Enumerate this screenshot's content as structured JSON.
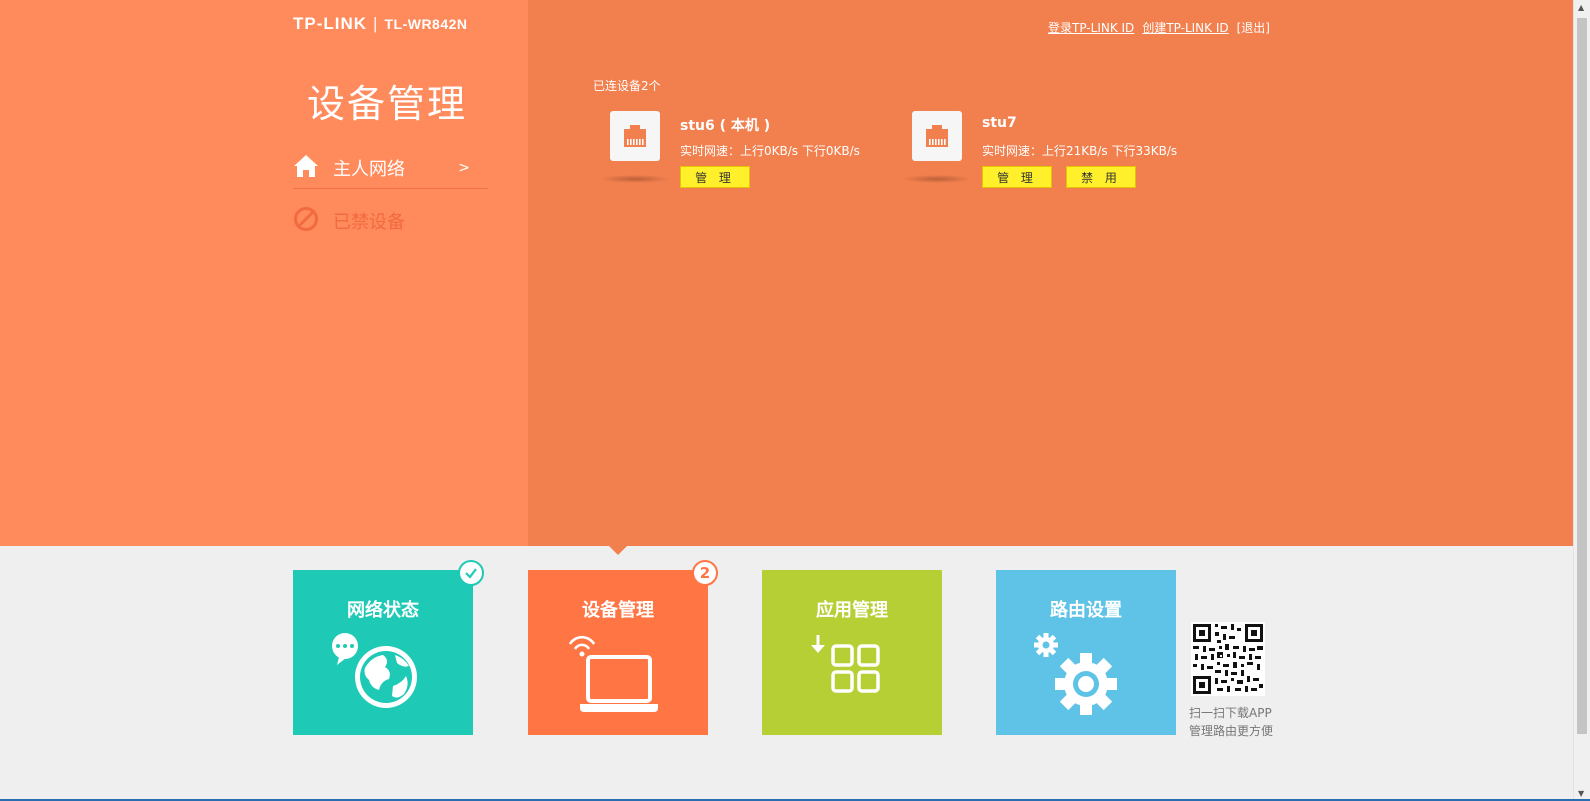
{
  "header": {
    "brand": "TP-LINK",
    "separator": "|",
    "model": "TL-WR842N",
    "links": {
      "login": "登录TP-LINK ID",
      "create": "创建TP-LINK ID",
      "logout": "[退出]"
    }
  },
  "sidebar": {
    "title": "设备管理",
    "items": [
      {
        "label": "主人网络",
        "arrow": ">",
        "icon": "home-icon"
      },
      {
        "label": "已禁设备",
        "icon": "blocked-icon"
      }
    ]
  },
  "devices": {
    "count_label": "已连设备2个",
    "list": [
      {
        "name": "stu6 ( 本机 )",
        "speed": "实时网速：上行0KB/s  下行0KB/s",
        "manage": "管 理"
      },
      {
        "name": "stu7",
        "speed": "实时网速：上行21KB/s  下行33KB/s",
        "manage": "管 理",
        "block": "禁 用"
      }
    ]
  },
  "tiles": [
    {
      "label": "网络状态",
      "color": "#1ecab6",
      "icon": "globe-chat-icon"
    },
    {
      "label": "设备管理",
      "color": "#ff7544",
      "icon": "laptop-wifi-icon",
      "badge": "2"
    },
    {
      "label": "应用管理",
      "color": "#b5cf34",
      "icon": "apps-grid-icon"
    },
    {
      "label": "路由设置",
      "color": "#5ec3e6",
      "icon": "gears-icon"
    }
  ],
  "qr": {
    "line1": "扫一扫下载APP",
    "line2": "管理路由更方便"
  },
  "colors": {
    "top_bg": "#f27f4e",
    "sidebar_bg": "#ff8a5c",
    "button": "#fff02b",
    "page_bg": "#efefef"
  }
}
